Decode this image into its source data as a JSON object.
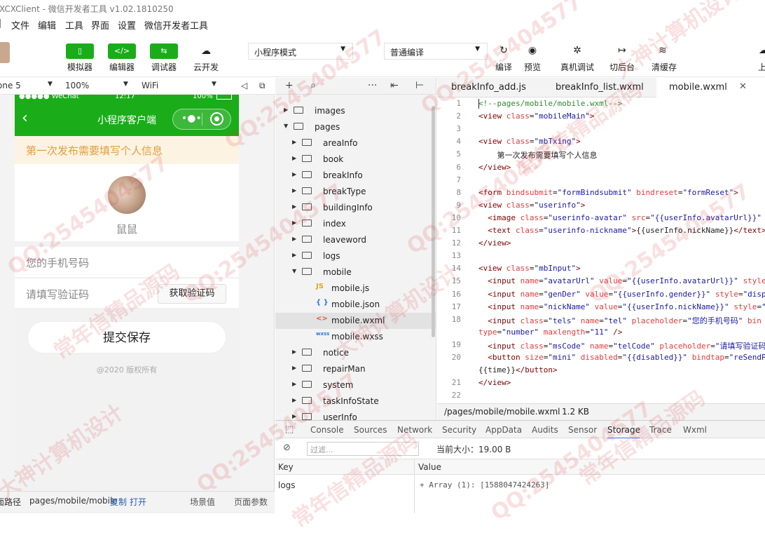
{
  "window": {
    "title": "XCXClient - 微信开发者工具 v1.02.1810250"
  },
  "menu": [
    "文件",
    "编辑",
    "工具",
    "界面",
    "设置",
    "微信开发者工具"
  ],
  "toolbar": {
    "simulator": "模拟器",
    "editor": "编辑器",
    "debugger": "调试器",
    "cloud": "云开发",
    "mode_select": "小程序模式",
    "compile_select": "普通编译",
    "compile": "编译",
    "preview": "预览",
    "remote_debug": "真机调试",
    "backstage": "切后台",
    "clear_cache": "清缓存",
    "upload": "上"
  },
  "simulator": {
    "device": "one 5",
    "zoom": "100%",
    "network": "WiFi",
    "status_left": "●●●●● WeChat",
    "status_time": "12:17",
    "status_battery": "100%",
    "nav_title": "小程序客户端",
    "notice": "第一次发布需要填写个人信息",
    "nickname": "鼠鼠",
    "phone_placeholder": "您的手机号码",
    "code_placeholder": "请填写验证码",
    "get_code_button": "获取验证码",
    "submit_button": "提交保存",
    "copyright": "@2020 版权所有"
  },
  "sim_footer": {
    "path_label": "面路径",
    "path": "pages/mobile/mobile",
    "copy": "复制",
    "open": "打开",
    "scene": "场景值",
    "params": "页面参数"
  },
  "explorer": {
    "items": [
      {
        "label": "images",
        "type": "folder",
        "open": false
      },
      {
        "label": "pages",
        "type": "folder",
        "open": true
      },
      {
        "label": "areaInfo",
        "type": "folder",
        "open": false
      },
      {
        "label": "book",
        "type": "folder",
        "open": false
      },
      {
        "label": "breakInfo",
        "type": "folder",
        "open": false
      },
      {
        "label": "breakType",
        "type": "folder",
        "open": false
      },
      {
        "label": "buildingInfo",
        "type": "folder",
        "open": false
      },
      {
        "label": "index",
        "type": "folder",
        "open": false
      },
      {
        "label": "leaveword",
        "type": "folder",
        "open": false
      },
      {
        "label": "logs",
        "type": "folder",
        "open": false
      },
      {
        "label": "mobile",
        "type": "folder",
        "open": true
      },
      {
        "label": "mobile.js",
        "type": "js",
        "open": false
      },
      {
        "label": "mobile.json",
        "type": "json",
        "open": false
      },
      {
        "label": "mobile.wxml",
        "type": "wxml",
        "open": false
      },
      {
        "label": "mobile.wxss",
        "type": "wxss",
        "open": false
      },
      {
        "label": "notice",
        "type": "folder",
        "open": false
      },
      {
        "label": "repairMan",
        "type": "folder",
        "open": false
      },
      {
        "label": "system",
        "type": "folder",
        "open": false
      },
      {
        "label": "taskInfoState",
        "type": "folder",
        "open": false
      },
      {
        "label": "userInfo",
        "type": "folder",
        "open": false
      }
    ]
  },
  "tabs": [
    "breakInfo_add.js",
    "breakInfo_list.wxml",
    "mobile.wxml"
  ],
  "editor": {
    "lines": [
      {
        "n": "1",
        "html": "<span class='cm'>&lt;!--pages/mobile/mobile.wxml--&gt;</span>"
      },
      {
        "n": "2",
        "html": "<span class='tg'>&lt;view</span> <span class='at'>class</span>=<span class='vl'>\"mobileMain\"</span><span class='tg'>&gt;</span>"
      },
      {
        "n": "3",
        "html": ""
      },
      {
        "n": "4",
        "html": "<span class='tg'>&lt;view</span> <span class='at'>class</span>=<span class='vl'>\"mbTxing\"</span><span class='tg'>&gt;</span>"
      },
      {
        "n": "5",
        "html": "    第一次发布需要填写个人信息"
      },
      {
        "n": "6",
        "html": "<span class='tg'>&lt;/view&gt;</span>"
      },
      {
        "n": "7",
        "html": ""
      },
      {
        "n": "8",
        "html": "<span class='tg'>&lt;form</span> <span class='at'>bindsubmit</span>=<span class='vl'>\"formBindsubmit\"</span> <span class='at'>bindreset</span>=<span class='vl'>\"formReset\"</span><span class='tg'>&gt;</span>"
      },
      {
        "n": "9",
        "html": "<span class='tg'>&lt;view</span> <span class='at'>class</span>=<span class='vl'>\"userinfo\"</span><span class='tg'>&gt;</span>"
      },
      {
        "n": "10",
        "html": "  <span class='tg'>&lt;image</span> <span class='at'>class</span>=<span class='vl'>\"userinfo-avatar\"</span> <span class='at'>src</span>=<span class='vl'>\"{{userInfo.avatarUrl}}\"</span>"
      },
      {
        "n": "11",
        "html": "  <span class='tg'>&lt;text</span> <span class='at'>class</span>=<span class='vl'>\"userinfo-nickname\"</span><span class='tg'>&gt;</span>{{userInfo.nickName}}<span class='tg'>&lt;/text&gt;</span>"
      },
      {
        "n": "12",
        "html": "<span class='tg'>&lt;/view&gt;</span>"
      },
      {
        "n": "13",
        "html": ""
      },
      {
        "n": "14",
        "html": "<span class='tg'>&lt;view</span> <span class='at'>class</span>=<span class='vl'>\"mbInput\"</span><span class='tg'>&gt;</span>"
      },
      {
        "n": "15",
        "html": "  <span class='tg'>&lt;input</span> <span class='at'>name</span>=<span class='vl'>\"avatarUrl\"</span> <span class='at'>value</span>=<span class='vl'>\"{{userInfo.avatarUrl}}\"</span> <span class='at'>style</span>"
      },
      {
        "n": "16",
        "html": "  <span class='tg'>&lt;input</span> <span class='at'>name</span>=<span class='vl'>\"genDer\"</span> <span class='at'>value</span>=<span class='vl'>\"{{userInfo.gender}}\"</span> <span class='at'>style</span>=<span class='vl'>\"disp</span>"
      },
      {
        "n": "17",
        "html": "  <span class='tg'>&lt;input</span> <span class='at'>name</span>=<span class='vl'>\"nickName\"</span> <span class='at'>value</span>=<span class='vl'>\"{{userInfo.nickName}}\"</span> <span class='at'>style</span>=<span class='vl'>\"</span>"
      },
      {
        "n": "18",
        "html": "  <span class='tg'>&lt;input</span> <span class='at'>class</span>=<span class='vl'>\"tels\"</span> <span class='at'>name</span>=<span class='vl'>\"tel\"</span> <span class='at'>placeholder</span>=<span class='vl'>\"您的手机号码\"</span> <span class='at'>bin</span>"
      },
      {
        "n": "",
        "html": "<span class='at'>type</span>=<span class='vl'>\"number\"</span> <span class='at'>maxlength</span>=<span class='vl'>\"11\"</span> <span class='tg'>/&gt;</span>"
      },
      {
        "n": "19",
        "html": "  <span class='tg'>&lt;input</span> <span class='at'>class</span>=<span class='vl'>\"msCode\"</span> <span class='at'>name</span>=<span class='vl'>\"telCode\"</span> <span class='at'>placeholder</span>=<span class='vl'>\"请填写验证码</span>"
      },
      {
        "n": "20",
        "html": "  <span class='tg'>&lt;button</span> <span class='at'>size</span>=<span class='vl'>\"mini\"</span> <span class='at'>disabled</span>=<span class='vl'>\"{{disabled}}\"</span> <span class='at'>bindtap</span>=<span class='vl'>\"reSendP</span>"
      },
      {
        "n": "",
        "html": "{{time}}<span class='tg'>&lt;/button&gt;</span>"
      },
      {
        "n": "21",
        "html": "<span class='tg'>&lt;/view&gt;</span>"
      },
      {
        "n": "22",
        "html": ""
      }
    ]
  },
  "editor_status": {
    "path": "/pages/mobile/mobile.wxml",
    "size": "1.2 KB"
  },
  "devtools": {
    "tabs": [
      "Console",
      "Sources",
      "Network",
      "Security",
      "AppData",
      "Audits",
      "Sensor",
      "Storage",
      "Trace",
      "Wxml"
    ],
    "active_tab": "Storage",
    "filter_placeholder": "过滤...",
    "current_size": "当前大小：19.00 B",
    "col_key": "Key",
    "col_value": "Value",
    "row_key": "logs",
    "row_value": "+ Array (1): [1588047424263]"
  },
  "watermarks": [
    "QQ:2545404577",
    "常年信精品源码",
    "大神计算机设计"
  ],
  "colors": {
    "accent": "#1aad19",
    "notice_bg": "#fdf3e2",
    "notice_text": "#e0a040"
  }
}
